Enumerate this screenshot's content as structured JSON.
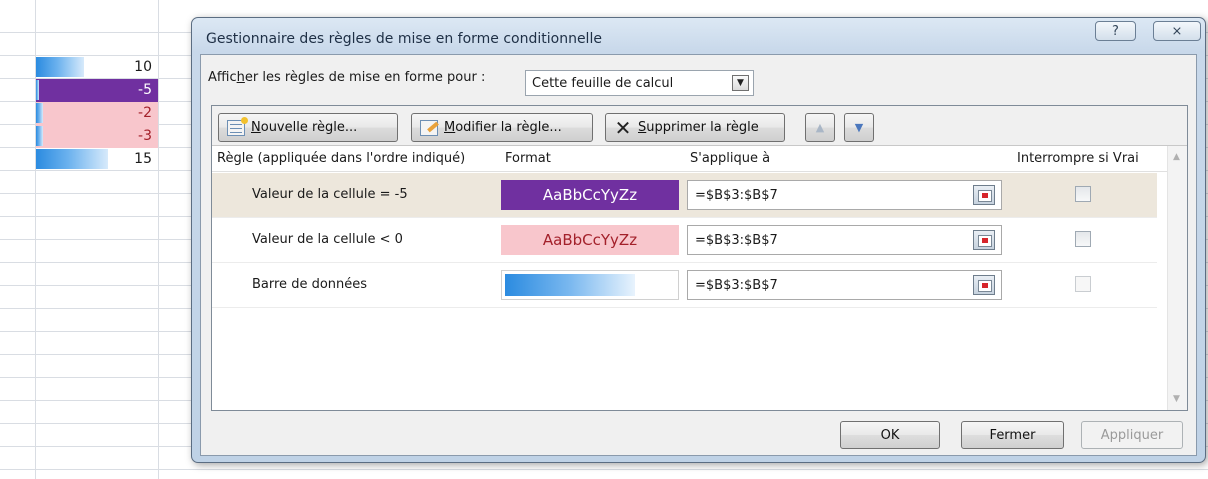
{
  "sheet": {
    "cells": [
      {
        "value": "10",
        "style": "databar",
        "bar_fraction": 0.67
      },
      {
        "value": "-5",
        "style": "purple",
        "bar_fraction": 0.04
      },
      {
        "value": "-2",
        "style": "pink",
        "bar_fraction": 0.1
      },
      {
        "value": "-3",
        "style": "pink",
        "bar_fraction": 0.1
      },
      {
        "value": "15",
        "style": "databar",
        "bar_fraction": 1.0
      }
    ]
  },
  "dialog": {
    "title": "Gestionnaire des règles de mise en forme conditionnelle",
    "help_glyph": "?",
    "close_glyph": "⨯",
    "show_rules_label_pre": "Affic",
    "show_rules_label_ul": "h",
    "show_rules_label_post": "er les règles de mise en forme pour :",
    "scope_value": "Cette feuille de calcul",
    "toolbar": {
      "new_ul": "N",
      "new_rest": "ouvelle règle...",
      "edit_ul": "M",
      "edit_rest": "odifier la règle...",
      "delete_ul": "S",
      "delete_rest": "upprimer la règle"
    },
    "columns": {
      "rule": "Règle (appliquée dans l'ordre indiqué)",
      "format": "Format",
      "applies_to": "S'applique à",
      "stop_if_true": "Interrompre si Vrai"
    },
    "rules": [
      {
        "name": "Valeur de la cellule = -5",
        "preview_text": "AaBbCcYyZz",
        "preview_style": "purple",
        "applies_to": "=$B$3:$B$7",
        "stop_if_true": false,
        "selected": true
      },
      {
        "name": "Valeur de la cellule < 0",
        "preview_text": "AaBbCcYyZz",
        "preview_style": "pink",
        "applies_to": "=$B$3:$B$7",
        "stop_if_true": false,
        "selected": false
      },
      {
        "name": "Barre de données",
        "preview_text": "",
        "preview_style": "databar",
        "applies_to": "=$B$3:$B$7",
        "stop_if_true": false,
        "selected": false
      }
    ],
    "buttons": {
      "ok": "OK",
      "close": "Fermer",
      "apply": "Appliquer"
    }
  },
  "colors": {
    "purple_fill": "#7030a0",
    "pink_fill": "#f8c6cc",
    "pink_text": "#a3202a",
    "databar_blue": "#2b8be0"
  }
}
